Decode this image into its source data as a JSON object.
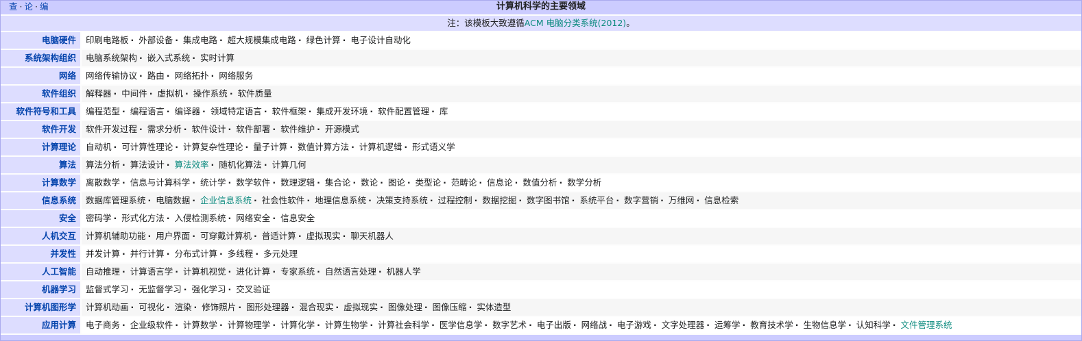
{
  "title": "计算机科学的主要领域",
  "vte": [
    "查",
    "论",
    "编"
  ],
  "note": {
    "prefix": "注：该模板大致遵循",
    "link": "ACM 电脑分类系统(2012)",
    "suffix": "。"
  },
  "colors": {
    "link": "#0645ad",
    "visited_link": "#0b8a7e",
    "group_bg": "#ddddff",
    "title_bg": "#ccccff"
  },
  "rows": [
    {
      "group": "电脑硬件",
      "items": [
        {
          "t": "印刷电路板"
        },
        {
          "t": "外部设备"
        },
        {
          "t": "集成电路"
        },
        {
          "t": "超大规模集成电路"
        },
        {
          "t": "绿色计算"
        },
        {
          "t": "电子设计自动化"
        }
      ]
    },
    {
      "group": "系统架构组织",
      "items": [
        {
          "t": "电脑系统架构"
        },
        {
          "t": "嵌入式系统"
        },
        {
          "t": "实时计算"
        }
      ]
    },
    {
      "group": "网络",
      "items": [
        {
          "t": "网络传输协议"
        },
        {
          "t": "路由"
        },
        {
          "t": "网络拓扑"
        },
        {
          "t": "网络服务"
        }
      ]
    },
    {
      "group": "软件组织",
      "items": [
        {
          "t": "解释器"
        },
        {
          "t": "中间件"
        },
        {
          "t": "虚拟机"
        },
        {
          "t": "操作系统"
        },
        {
          "t": "软件质量"
        }
      ]
    },
    {
      "group": "软件符号和工具",
      "items": [
        {
          "t": "编程范型"
        },
        {
          "t": "编程语言"
        },
        {
          "t": "编译器"
        },
        {
          "t": "领域特定语言"
        },
        {
          "t": "软件框架"
        },
        {
          "t": "集成开发环境"
        },
        {
          "t": "软件配置管理"
        },
        {
          "t": "库"
        }
      ]
    },
    {
      "group": "软件开发",
      "items": [
        {
          "t": "软件开发过程"
        },
        {
          "t": "需求分析"
        },
        {
          "t": "软件设计"
        },
        {
          "t": "软件部署"
        },
        {
          "t": "软件维护"
        },
        {
          "t": "开源模式"
        }
      ]
    },
    {
      "group": "计算理论",
      "items": [
        {
          "t": "自动机"
        },
        {
          "t": "可计算性理论"
        },
        {
          "t": "计算复杂性理论"
        },
        {
          "t": "量子计算"
        },
        {
          "t": "数值计算方法"
        },
        {
          "t": "计算机逻辑"
        },
        {
          "t": "形式语义学"
        }
      ]
    },
    {
      "group": "算法",
      "items": [
        {
          "t": "算法分析"
        },
        {
          "t": "算法设计"
        },
        {
          "t": "算法效率",
          "v": true
        },
        {
          "t": "随机化算法"
        },
        {
          "t": "计算几何"
        }
      ]
    },
    {
      "group": "计算数学",
      "items": [
        {
          "t": "离散数学"
        },
        {
          "t": "信息与计算科学"
        },
        {
          "t": "统计学"
        },
        {
          "t": "数学软件"
        },
        {
          "t": "数理逻辑"
        },
        {
          "t": "集合论"
        },
        {
          "t": "数论"
        },
        {
          "t": "图论"
        },
        {
          "t": "类型论"
        },
        {
          "t": "范畴论"
        },
        {
          "t": "信息论"
        },
        {
          "t": "数值分析"
        },
        {
          "t": "数学分析"
        }
      ]
    },
    {
      "group": "信息系统",
      "items": [
        {
          "t": "数据库管理系统"
        },
        {
          "t": "电脑数据"
        },
        {
          "t": "企业信息系统",
          "v": true
        },
        {
          "t": "社会性软件"
        },
        {
          "t": "地理信息系统"
        },
        {
          "t": "决策支持系统"
        },
        {
          "t": "过程控制"
        },
        {
          "t": "数据挖掘"
        },
        {
          "t": "数字图书馆"
        },
        {
          "t": "系统平台"
        },
        {
          "t": "数字营销"
        },
        {
          "t": "万维网"
        },
        {
          "t": "信息检索"
        }
      ]
    },
    {
      "group": "安全",
      "items": [
        {
          "t": "密码学"
        },
        {
          "t": "形式化方法"
        },
        {
          "t": "入侵检测系统"
        },
        {
          "t": "网络安全"
        },
        {
          "t": "信息安全"
        }
      ]
    },
    {
      "group": "人机交互",
      "items": [
        {
          "t": "计算机辅助功能"
        },
        {
          "t": "用户界面"
        },
        {
          "t": "可穿戴计算机"
        },
        {
          "t": "普适计算"
        },
        {
          "t": "虚拟现实"
        },
        {
          "t": "聊天机器人"
        }
      ]
    },
    {
      "group": "并发性",
      "items": [
        {
          "t": "并发计算"
        },
        {
          "t": "并行计算"
        },
        {
          "t": "分布式计算"
        },
        {
          "t": "多线程"
        },
        {
          "t": "多元处理"
        }
      ]
    },
    {
      "group": "人工智能",
      "items": [
        {
          "t": "自动推理"
        },
        {
          "t": "计算语言学"
        },
        {
          "t": "计算机视觉"
        },
        {
          "t": "进化计算"
        },
        {
          "t": "专家系统"
        },
        {
          "t": "自然语言处理"
        },
        {
          "t": "机器人学"
        }
      ]
    },
    {
      "group": "机器学习",
      "items": [
        {
          "t": "监督式学习"
        },
        {
          "t": "无监督学习"
        },
        {
          "t": "强化学习"
        },
        {
          "t": "交叉验证"
        }
      ]
    },
    {
      "group": "计算机图形学",
      "items": [
        {
          "t": "计算机动画"
        },
        {
          "t": "可视化"
        },
        {
          "t": "渲染"
        },
        {
          "t": "修饰照片"
        },
        {
          "t": "图形处理器"
        },
        {
          "t": "混合现实"
        },
        {
          "t": "虚拟现实"
        },
        {
          "t": "图像处理"
        },
        {
          "t": "图像压缩"
        },
        {
          "t": "实体造型"
        }
      ]
    },
    {
      "group": "应用计算",
      "items": [
        {
          "t": "电子商务"
        },
        {
          "t": "企业级软件"
        },
        {
          "t": "计算数学"
        },
        {
          "t": "计算物理学"
        },
        {
          "t": "计算化学"
        },
        {
          "t": "计算生物学"
        },
        {
          "t": "计算社会科学"
        },
        {
          "t": "医学信息学"
        },
        {
          "t": "数字艺术"
        },
        {
          "t": "电子出版"
        },
        {
          "t": "网络战"
        },
        {
          "t": "电子游戏"
        },
        {
          "t": "文字处理器"
        },
        {
          "t": "运筹学"
        },
        {
          "t": "教育技术学"
        },
        {
          "t": "生物信息学"
        },
        {
          "t": "认知科学"
        },
        {
          "t": "文件管理系统",
          "v": true
        }
      ]
    }
  ]
}
